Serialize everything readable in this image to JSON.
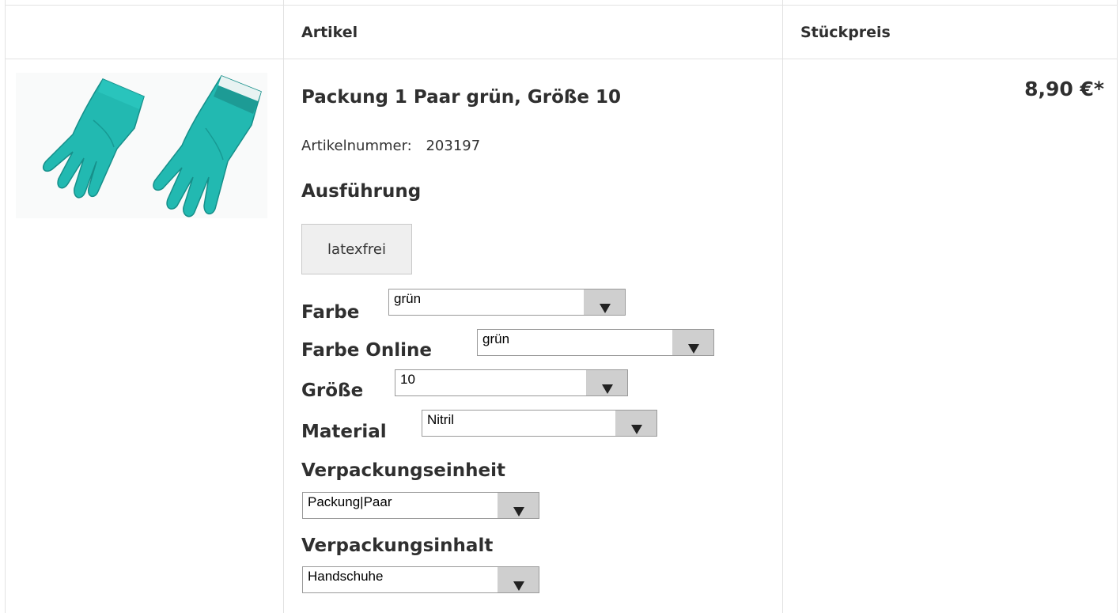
{
  "header": {
    "col_article": "Artikel",
    "col_unit_price": "Stückpreis"
  },
  "product": {
    "title": "Packung 1 Paar grün, Größe 10",
    "article_number_label": "Artikelnummer:",
    "article_number": "203197",
    "image_icon": "green-gloves-image",
    "price": "8,90 €*"
  },
  "variant": {
    "heading": "Ausführung",
    "option": "latexfrei"
  },
  "fields": {
    "farbe": {
      "label": "Farbe",
      "value": "grün"
    },
    "farbe_online": {
      "label": "Farbe Online",
      "value": "grün"
    },
    "groesse": {
      "label": "Größe",
      "value": "10"
    },
    "material": {
      "label": "Material",
      "value": "Nitril"
    },
    "verpackungseinheit": {
      "label": "Verpackungseinheit",
      "value": "Packung|Paar"
    },
    "verpackungsinhalt": {
      "label": "Verpackungsinhalt",
      "value": "Handschuhe"
    }
  },
  "colors": {
    "glove": "#1fb8b0",
    "glove_shadow": "#158f8a",
    "select_arrow_bg": "#cfcfcf"
  }
}
